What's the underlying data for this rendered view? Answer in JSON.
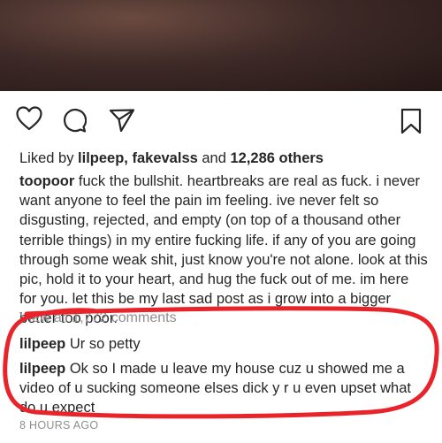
{
  "icons": [
    "heart-icon",
    "comment-icon",
    "share-icon",
    "bookmark-icon"
  ],
  "likes": {
    "prefix": "Liked by ",
    "users": "lilpeep, fakevalss",
    "middle": " and ",
    "others": "12,286 others"
  },
  "caption": {
    "user": "toopoor",
    "text": " fuck the bullshit. heartbreaks are real as fuck. i never want anyone to feel the pain im feeling. ive never felt so disgusting, rejected, and empty (on top of a thousand other terrible things) in my entire fucking life. if any of you are going through some weak shit, just know you're not alone. look at this pic, hold it to your heart, and hug the fuck out of me. im here for you. let this be my last sad post as i grow into a bigger better too poor."
  },
  "view_all": "View all 1,772 comments",
  "comments": [
    {
      "user": "lilpeep",
      "text": " Ur so petty"
    },
    {
      "user": "lilpeep",
      "text": " Ok so I made u leave my house  cuz u showed me a video of u sucking someone elses dick y r u even upset what do u expect"
    }
  ],
  "timestamp": "8 HOURS AGO",
  "colors": {
    "highlight": "#e8242a",
    "muted": "#8e8e8e",
    "text": "#262626"
  }
}
